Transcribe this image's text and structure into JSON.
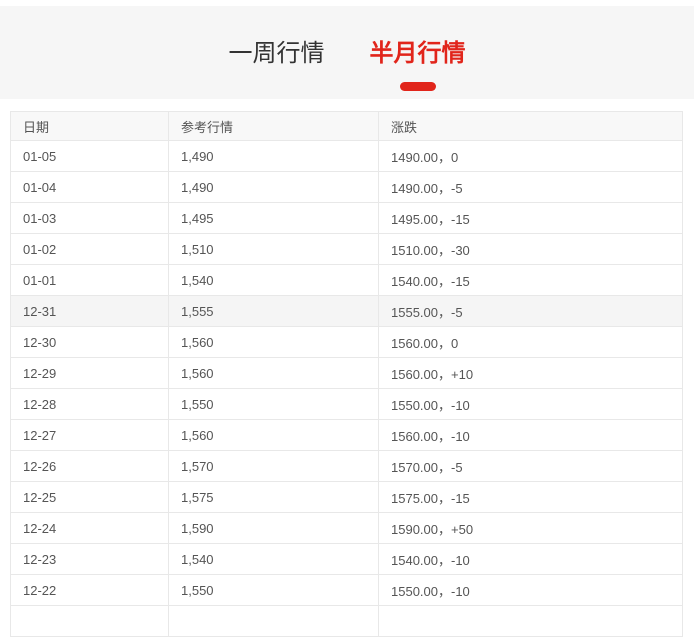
{
  "accent_color": "#e1251b",
  "tabs": [
    {
      "label": "一周行情",
      "active": false
    },
    {
      "label": "半月行情",
      "active": true
    }
  ],
  "table": {
    "columns": [
      "日期",
      "参考行情",
      "涨跌"
    ],
    "rows": [
      [
        "01-05",
        "1,490",
        "1490.00，0"
      ],
      [
        "01-04",
        "1,490",
        "1490.00，-5"
      ],
      [
        "01-03",
        "1,495",
        "1495.00，-15"
      ],
      [
        "01-02",
        "1,510",
        "1510.00，-30"
      ],
      [
        "01-01",
        "1,540",
        "1540.00，-15"
      ],
      [
        "12-31",
        "1,555",
        "1555.00，-5"
      ],
      [
        "12-30",
        "1,560",
        "1560.00，0"
      ],
      [
        "12-29",
        "1,560",
        "1560.00，+10"
      ],
      [
        "12-28",
        "1,550",
        "1550.00，-10"
      ],
      [
        "12-27",
        "1,560",
        "1560.00，-10"
      ],
      [
        "12-26",
        "1,570",
        "1570.00，-5"
      ],
      [
        "12-25",
        "1,575",
        "1575.00，-15"
      ],
      [
        "12-24",
        "1,590",
        "1590.00，+50"
      ],
      [
        "12-23",
        "1,540",
        "1540.00，-10"
      ],
      [
        "12-22",
        "1,550",
        "1550.00，-10"
      ]
    ],
    "highlighted_row_index": 5
  }
}
